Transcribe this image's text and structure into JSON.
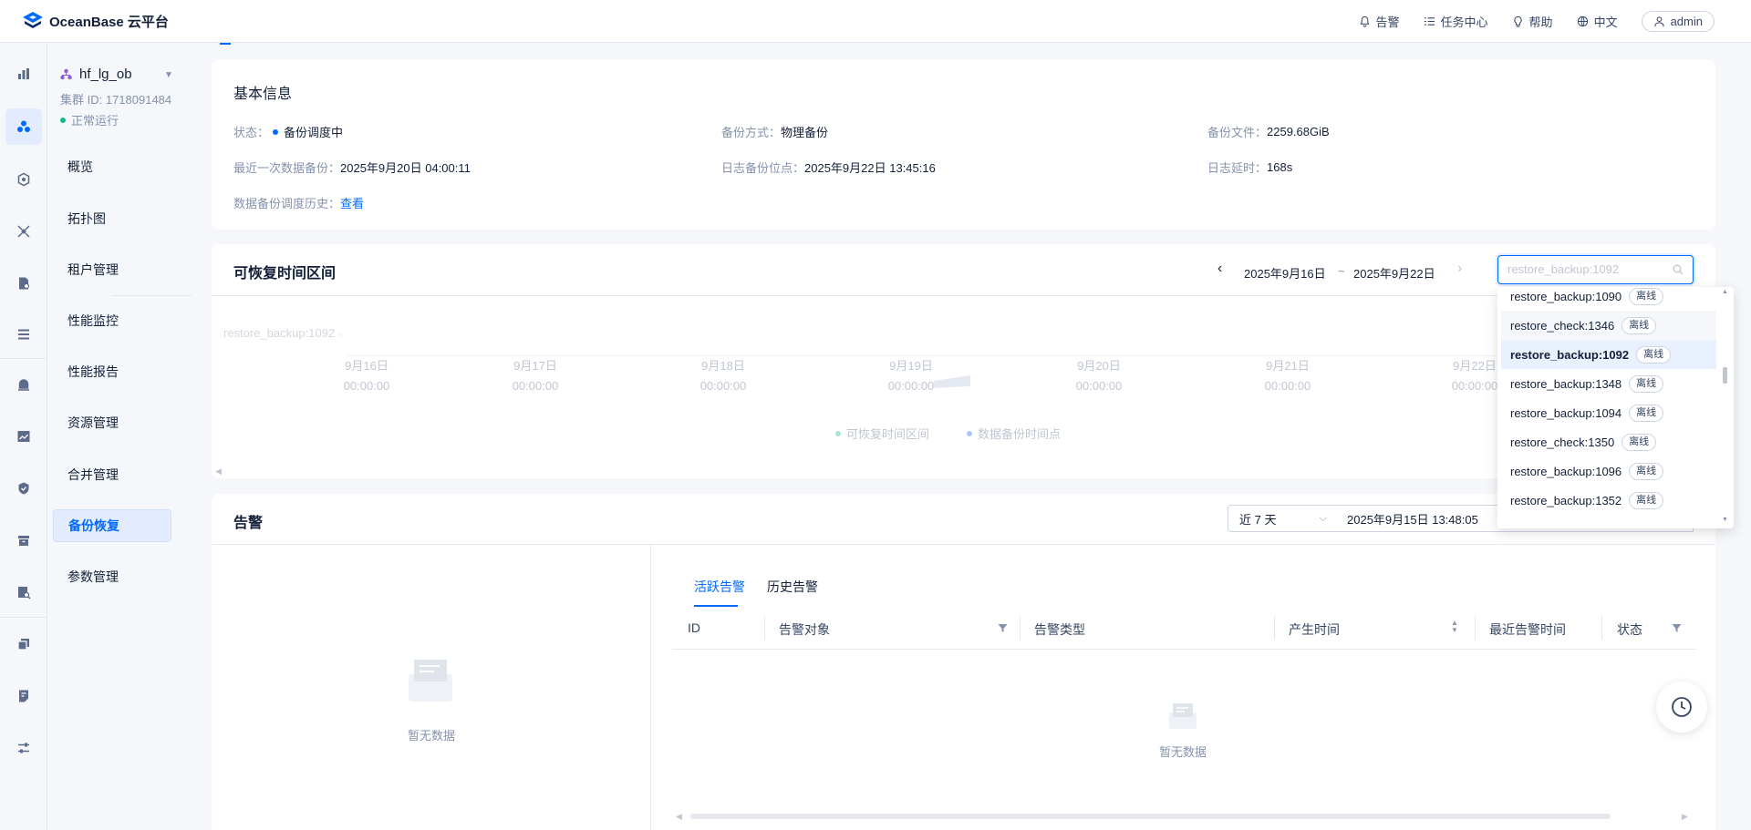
{
  "app": {
    "title": "OceanBase 云平台"
  },
  "topbar": {
    "alarm": "告警",
    "tasks": "任务中心",
    "help": "帮助",
    "lang": "中文",
    "user": "admin"
  },
  "cluster": {
    "name": "hf_lg_ob",
    "id": "集群 ID: 1718091484",
    "status": "正常运行"
  },
  "sidebar": {
    "items": [
      {
        "label": "概览"
      },
      {
        "label": "拓扑图"
      },
      {
        "label": "租户管理"
      },
      {
        "label": "性能监控"
      },
      {
        "label": "性能报告"
      },
      {
        "label": "资源管理"
      },
      {
        "label": "合并管理"
      },
      {
        "label": "备份恢复"
      },
      {
        "label": "参数管理"
      }
    ]
  },
  "basic": {
    "title": "基本信息",
    "status_label": "状态：",
    "status_value": "备份调度中",
    "method_label": "备份方式：",
    "method_value": "物理备份",
    "file_label": "备份文件：",
    "file_value": "2259.68GiB",
    "last_label": "最近一次数据备份：",
    "last_value": "2025年9月20日 04:00:11",
    "log_label": "日志备份位点：",
    "log_value": "2025年9月22日 13:45:16",
    "delay_label": "日志延时：",
    "delay_value": "168s",
    "history_label": "数据备份调度历史：",
    "history_link": "查看"
  },
  "recovery": {
    "title": "可恢复时间区间",
    "range_start": "2025年9月16日",
    "range_sep": "~",
    "range_end": "2025年9月22日",
    "search_placeholder": "restore_backup:1092",
    "track_label": "restore_backup:1092",
    "timeline": [
      {
        "date": "9月16日",
        "time": "00:00:00"
      },
      {
        "date": "9月17日",
        "time": "00:00:00"
      },
      {
        "date": "9月18日",
        "time": "00:00:00"
      },
      {
        "date": "9月19日",
        "time": "00:00:00"
      },
      {
        "date": "9月20日",
        "time": "00:00:00"
      },
      {
        "date": "9月21日",
        "time": "00:00:00"
      },
      {
        "date": "9月22日",
        "time": "00:00:00"
      }
    ],
    "legend_range": "可恢复时间区间",
    "legend_point": "数据备份时间点"
  },
  "dropdown": {
    "items": [
      {
        "name": "restore_backup:1090",
        "tag": "离线"
      },
      {
        "name": "restore_check:1346",
        "tag": "离线"
      },
      {
        "name": "restore_backup:1092",
        "tag": "离线"
      },
      {
        "name": "restore_backup:1348",
        "tag": "离线"
      },
      {
        "name": "restore_backup:1094",
        "tag": "离线"
      },
      {
        "name": "restore_check:1350",
        "tag": "离线"
      },
      {
        "name": "restore_backup:1096",
        "tag": "离线"
      },
      {
        "name": "restore_backup:1352",
        "tag": "离线"
      }
    ]
  },
  "alarm": {
    "title": "告警",
    "period": "近 7 天",
    "start_time": "2025年9月15日 13:48:05",
    "empty_left": "暂无数据",
    "tab_active": "活跃告警",
    "tab_history": "历史告警",
    "columns": [
      "ID",
      "告警对象",
      "告警类型",
      "产生时间",
      "最近告警时间",
      "状态"
    ],
    "empty_table": "暂无数据"
  },
  "colors": {
    "accent": "#006aff",
    "success": "#0ac185"
  }
}
